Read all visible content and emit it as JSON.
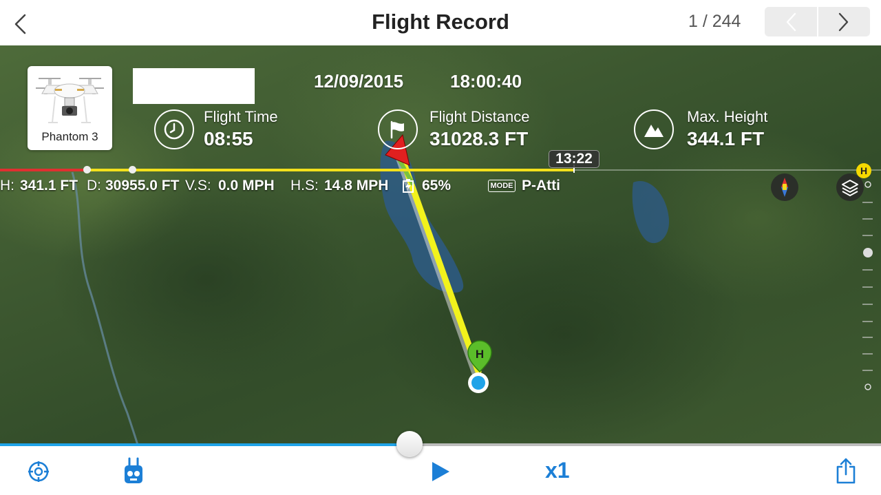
{
  "header": {
    "title": "Flight Record",
    "counter": "1 / 244"
  },
  "aircraft": {
    "name": "Phantom 3"
  },
  "record": {
    "date": "12/09/2015",
    "time": "18:00:40"
  },
  "stats": {
    "flight_time_label": "Flight Time",
    "flight_time_value": "08:55",
    "flight_distance_label": "Flight Distance",
    "flight_distance_value": "31028.3 FT",
    "max_height_label": "Max. Height",
    "max_height_value": "344.1 FT"
  },
  "timeline": {
    "time_tag": "13:22"
  },
  "telemetry": {
    "h_label": "H:",
    "h_value": "341.1 FT",
    "d_label": "D:",
    "d_value": "30955.0 FT",
    "vs_label": "V.S:",
    "vs_value": "0.0 MPH",
    "hs_label": "H.S:",
    "hs_value": "14.8 MPH",
    "battery_value": "65%",
    "mode_badge": "MODE",
    "mode_value": "P-Atti"
  },
  "map": {
    "home_marker": "H",
    "compass_badge": "H"
  },
  "playback": {
    "progress": 0.465,
    "speed": "x1"
  },
  "colors": {
    "accent_blue": "#1fa3e8",
    "track_yellow": "#f2e01c",
    "track_red": "#e03030",
    "home_green": "#5bbd2a"
  }
}
